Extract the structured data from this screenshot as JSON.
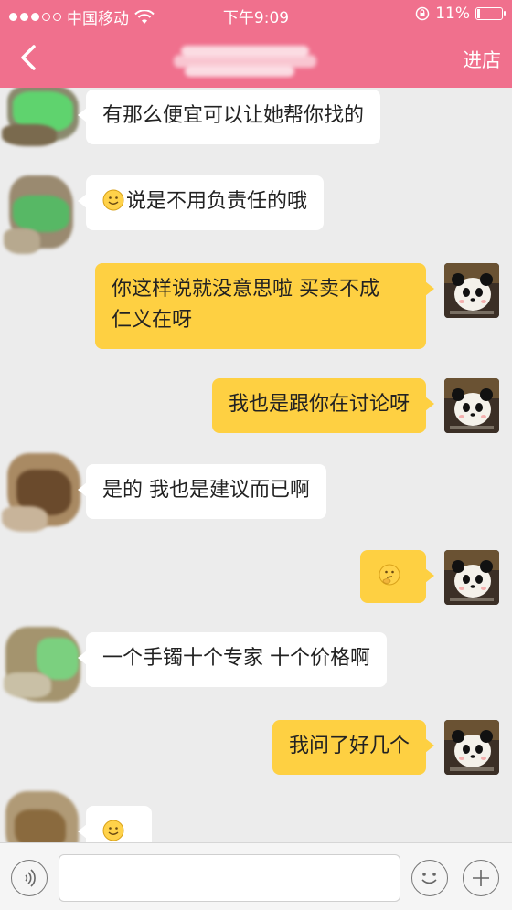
{
  "status_bar": {
    "carrier": "中国移动",
    "time": "下午9:09",
    "battery": "11%"
  },
  "header": {
    "action_label": "进店"
  },
  "messages": [
    {
      "side": "left",
      "text": "有那么便宜可以让她帮你找的"
    },
    {
      "side": "left",
      "text": "说是不用负责任的哦",
      "emoji": "smile-emoji"
    },
    {
      "side": "right",
      "line1": "你这样说就没意思啦 买卖不成",
      "line2": "仁义在呀"
    },
    {
      "side": "right",
      "text": "我也是跟你在讨论呀"
    },
    {
      "side": "left",
      "text": "是的 我也是建议而已啊"
    },
    {
      "side": "right",
      "emoji": "thinking-emoji"
    },
    {
      "side": "left",
      "text": "一个手镯十个专家 十个价格啊"
    },
    {
      "side": "right",
      "text": "我问了好几个"
    },
    {
      "side": "left",
      "emoji": "smile-emoji"
    }
  ],
  "colors": {
    "header": "#f0708d",
    "self_bubble": "#fed042",
    "other_bubble": "#ffffff",
    "background": "#ececec"
  }
}
